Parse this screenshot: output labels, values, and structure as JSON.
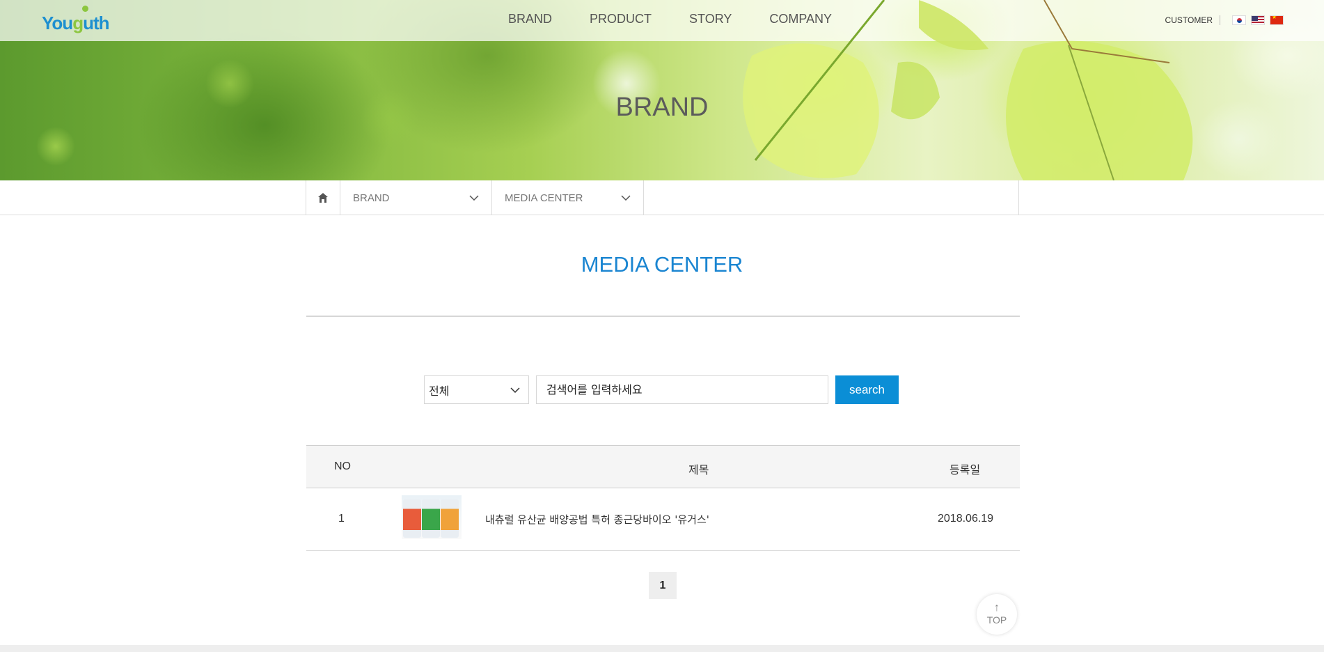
{
  "header": {
    "logo_text_1": "You",
    "logo_text_2": "g",
    "logo_text_3": "uth",
    "nav": [
      "BRAND",
      "PRODUCT",
      "STORY",
      "COMPANY"
    ],
    "customer_label": "CUSTOMER",
    "languages": [
      "korean-flag-icon",
      "us-flag-icon",
      "china-flag-icon"
    ]
  },
  "hero": {
    "title": "BRAND"
  },
  "breadcrumb": {
    "home_icon": "home-icon",
    "level1": "BRAND",
    "level2": "MEDIA CENTER"
  },
  "main": {
    "title": "MEDIA CENTER",
    "search": {
      "category": "전체",
      "placeholder": "검색어를 입력하세요",
      "button": "search"
    },
    "table": {
      "headers": {
        "no": "NO",
        "title": "제목",
        "date": "등록일"
      },
      "rows": [
        {
          "no": "1",
          "title": "내츄럴 유산균 배양공법 특허 종근당바이오 '유거스'",
          "date": "2018.06.19"
        }
      ]
    },
    "pagination": [
      "1"
    ]
  },
  "top_button": {
    "label": "TOP",
    "icon": "arrow-up-icon"
  },
  "colors": {
    "accent": "#0b8ed6",
    "title_blue": "#1a85d1",
    "logo_green": "#8cc63f"
  }
}
